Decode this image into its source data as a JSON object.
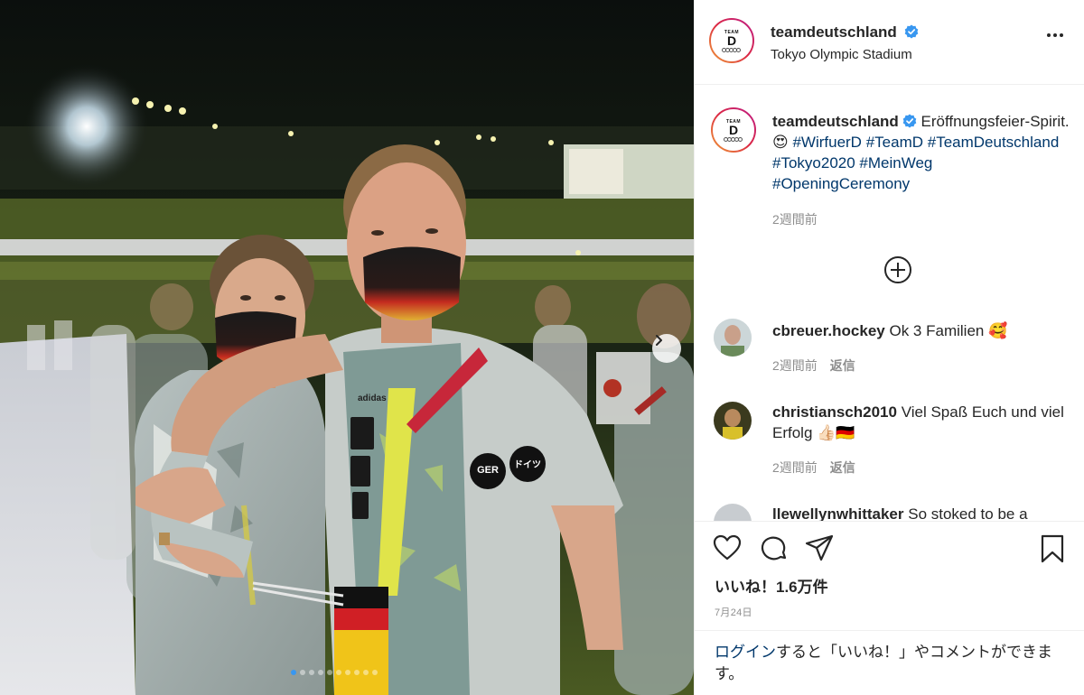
{
  "post": {
    "account": "teamdeutschland",
    "location": "Tokyo Olympic Stadium",
    "avatar_logo": {
      "line1": "TEAM",
      "line2": "D"
    },
    "caption": {
      "username": "teamdeutschland",
      "text_prefix": "Eröffnungsfeier-Spirit. 😍 ",
      "hashtags": [
        "#WirfuerD",
        "#TeamD",
        "#TeamDeutschland",
        "#Tokyo2020",
        "#MeinWeg",
        "#OpeningCeremony"
      ],
      "timestamp": "2週間前"
    },
    "comments": [
      {
        "username": "cbreuer.hockey",
        "text": "Ok 3 Familien 🥰",
        "timestamp": "2週間前",
        "reply_label": "返信"
      },
      {
        "username": "christiansch2010",
        "text": "Viel Spaß Euch und viel Erfolg 👍🏻🇩🇪",
        "timestamp": "2週間前",
        "reply_label": "返信"
      },
      {
        "username": "llewellynwhittaker",
        "text": "So stoked to be a"
      }
    ],
    "likes": "いいね！1.6万件",
    "date": "7月24日",
    "login_prompt": {
      "link": "ログイン",
      "rest": "すると「いいね！」やコメントができます。"
    },
    "photo": {
      "badge_left": "GER",
      "badge_right": "ドイツ",
      "brand": "adidas",
      "carousel_count": 10,
      "carousel_active": 0
    }
  },
  "icons": {
    "more": "more-options-icon",
    "verified": "verified-badge-icon",
    "add": "load-more-comments-icon",
    "like": "heart-icon",
    "comment": "comment-icon",
    "share": "share-icon",
    "save": "bookmark-icon",
    "next": "chevron-right-icon"
  },
  "colors": {
    "link": "#00376b",
    "verified": "#3897f0",
    "muted": "#8e8e8e",
    "text": "#262626"
  }
}
